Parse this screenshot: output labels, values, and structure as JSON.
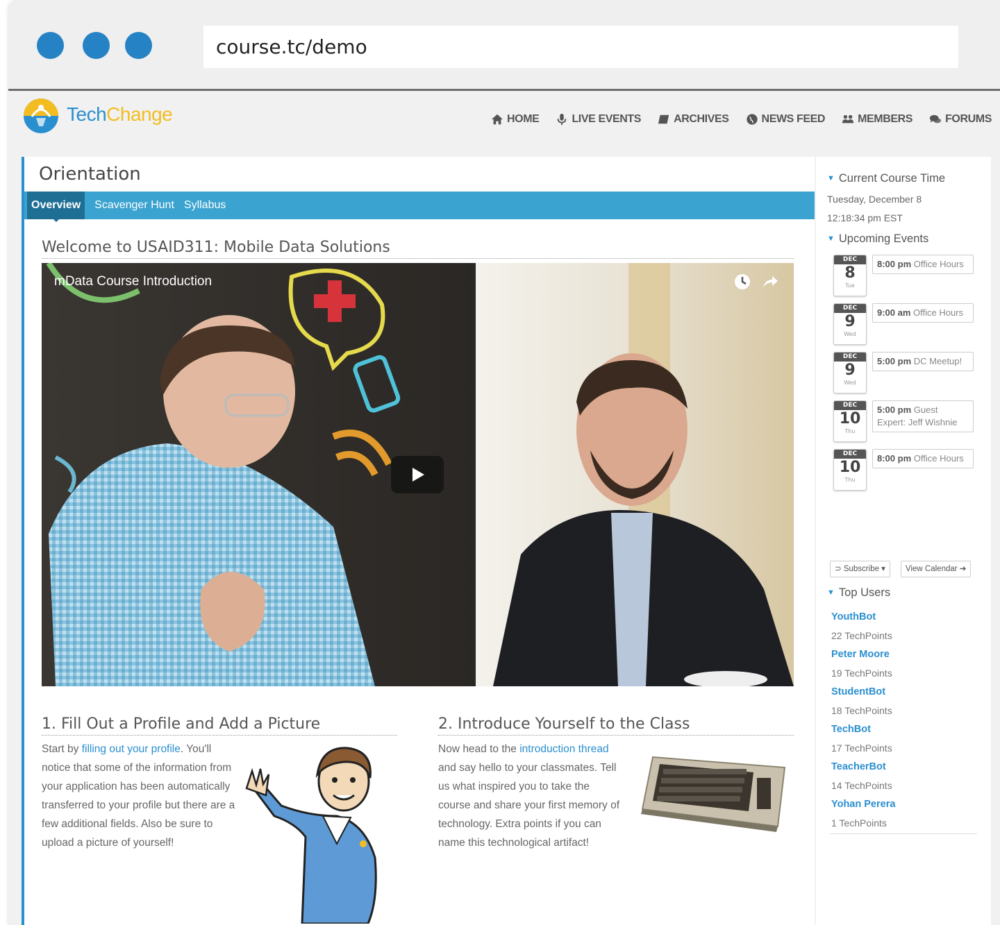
{
  "browser": {
    "url": "course.tc/demo",
    "colors": {
      "dots": "#2582c4"
    }
  },
  "header": {
    "brand_part1": "Tech",
    "brand_part2": "Change",
    "nav": [
      {
        "label": "HOME",
        "icon": "home-icon"
      },
      {
        "label": "LIVE EVENTS",
        "icon": "microphone-icon"
      },
      {
        "label": "ARCHIVES",
        "icon": "book-icon"
      },
      {
        "label": "NEWS FEED",
        "icon": "globe-icon"
      },
      {
        "label": "MEMBERS",
        "icon": "users-icon"
      },
      {
        "label": "FORUMS",
        "icon": "chat-icon"
      }
    ],
    "colors": {
      "brand_blue": "#2a8fcf",
      "brand_yellow": "#f3bd22"
    }
  },
  "main": {
    "title": "Orientation",
    "tabs": [
      "Overview",
      "Scavenger Hunt",
      "Syllabus"
    ],
    "welcome": "Welcome to USAID311: Mobile Data Solutions",
    "video": {
      "title": "mData Course Introduction"
    },
    "step1": {
      "heading": "1. Fill Out a Profile and Add a Picture",
      "text_before": "Start by ",
      "link": "filling out your profile",
      "text_after": ". You'll notice that some of the information from your application has been automatically transferred to your profile but there are a few additional fields. Also be sure to upload a picture of yourself!"
    },
    "step2": {
      "heading": "2. Introduce Yourself to the Class",
      "text_before": "Now head to the ",
      "link": "introduction thread",
      "text_after": " and say hello to your classmates. Tell us what inspired you to take the course and share your first memory of technology. Extra points if you can name this technological artifact!"
    }
  },
  "sidebar": {
    "course_time_heading": "Current Course Time",
    "date": "Tuesday, December 8",
    "time": "12:18:34 pm EST",
    "events_heading": "Upcoming Events",
    "events": [
      {
        "month": "DEC",
        "day": "8",
        "weekday": "Tue",
        "time": "8:00 pm",
        "title": "Office Hours"
      },
      {
        "month": "DEC",
        "day": "9",
        "weekday": "Wed",
        "time": "9:00 am",
        "title": "Office Hours"
      },
      {
        "month": "DEC",
        "day": "9",
        "weekday": "Wed",
        "time": "5:00 pm",
        "title": "DC Meetup!"
      },
      {
        "month": "DEC",
        "day": "10",
        "weekday": "Thu",
        "time": "5:00 pm",
        "title": "Guest Expert: Jeff Wishnie"
      },
      {
        "month": "DEC",
        "day": "10",
        "weekday": "Thu",
        "time": "8:00 pm",
        "title": "Office Hours"
      }
    ],
    "subscribe_label": "Subscribe",
    "view_calendar_label": "View Calendar",
    "top_users_heading": "Top Users",
    "top_users": [
      {
        "name": "YouthBot",
        "points": "22 TechPoints"
      },
      {
        "name": "Peter Moore",
        "points": "19 TechPoints"
      },
      {
        "name": "StudentBot",
        "points": "18 TechPoints"
      },
      {
        "name": "TechBot",
        "points": "17 TechPoints"
      },
      {
        "name": "TeacherBot",
        "points": "14 TechPoints"
      },
      {
        "name": "Yohan Perera",
        "points": "1 TechPoints"
      }
    ]
  }
}
